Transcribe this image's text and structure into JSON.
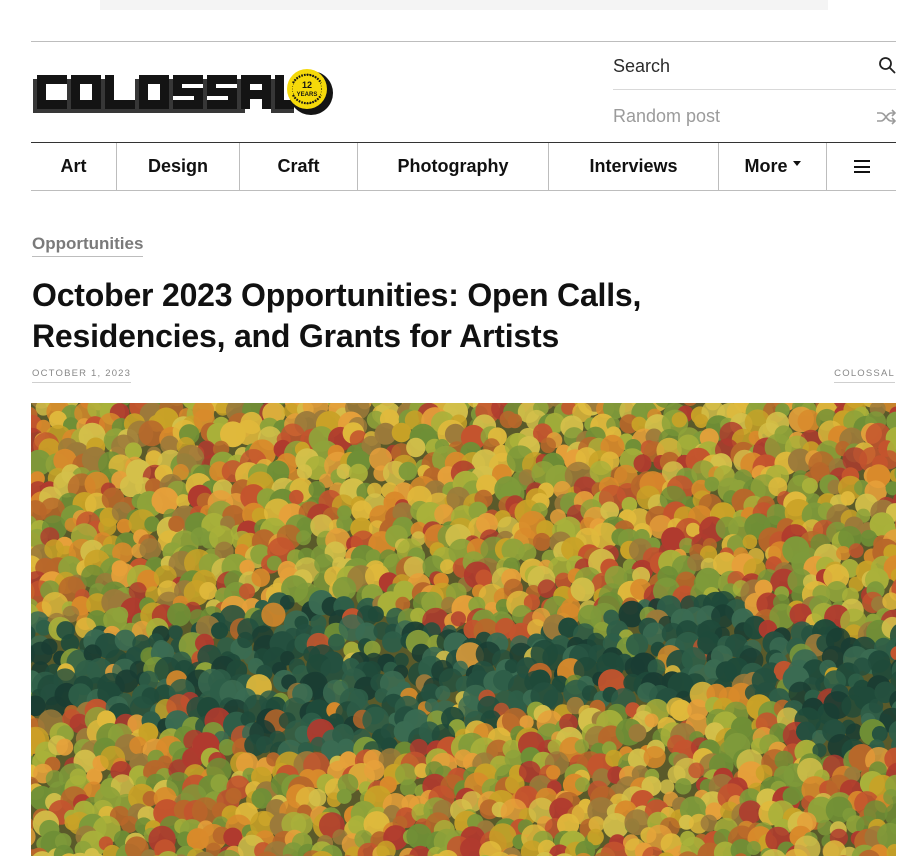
{
  "site": {
    "logo_text": "COLOSSAL",
    "badge_line1": "12",
    "badge_line2": "YEARS",
    "badge_ring": "OF ART & CULTURE"
  },
  "search": {
    "label": "Search",
    "icon": "search-icon"
  },
  "random_post": {
    "label": "Random post",
    "icon": "shuffle-icon"
  },
  "nav": {
    "items": [
      {
        "label": "Art"
      },
      {
        "label": "Design"
      },
      {
        "label": "Craft"
      },
      {
        "label": "Photography"
      },
      {
        "label": "Interviews"
      },
      {
        "label": "More"
      }
    ],
    "menu_icon": "hamburger-menu-icon"
  },
  "article": {
    "category": "Opportunities",
    "title": "October 2023 Opportunities: Open Calls, Residencies, and Grants for Artists",
    "date": "OCTOBER 1, 2023",
    "author": "COLOSSAL",
    "hero_image": "aerial autumn forest with orange, yellow and green treetops and a dark band of evergreens"
  },
  "colors": {
    "text": "#141414",
    "muted": "#7a7a7a",
    "badge_yellow": "#f5d90a"
  }
}
